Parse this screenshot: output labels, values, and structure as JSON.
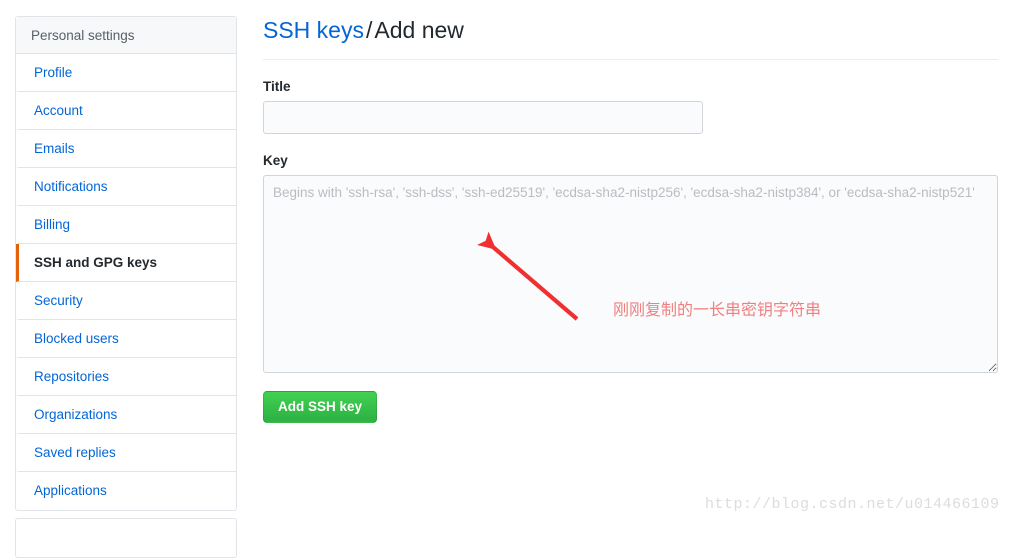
{
  "sidebar": {
    "header": "Personal settings",
    "items": [
      {
        "label": "Profile",
        "selected": false
      },
      {
        "label": "Account",
        "selected": false
      },
      {
        "label": "Emails",
        "selected": false
      },
      {
        "label": "Notifications",
        "selected": false
      },
      {
        "label": "Billing",
        "selected": false
      },
      {
        "label": "SSH and GPG keys",
        "selected": true
      },
      {
        "label": "Security",
        "selected": false
      },
      {
        "label": "Blocked users",
        "selected": false
      },
      {
        "label": "Repositories",
        "selected": false
      },
      {
        "label": "Organizations",
        "selected": false
      },
      {
        "label": "Saved replies",
        "selected": false
      },
      {
        "label": "Applications",
        "selected": false
      }
    ],
    "active_indicator_color": "#e36209"
  },
  "main": {
    "breadcrumb": {
      "link": "SSH keys",
      "separator": "/",
      "current": "Add new"
    },
    "form": {
      "title_label": "Title",
      "title_value": "",
      "title_placeholder": "",
      "key_label": "Key",
      "key_value": "",
      "key_placeholder": "Begins with 'ssh-rsa', 'ssh-dss', 'ssh-ed25519', 'ecdsa-sha2-nistp256', 'ecdsa-sha2-nistp384', or 'ecdsa-sha2-nistp521'",
      "submit_label": "Add SSH key",
      "submit_color": "#2eb344"
    }
  },
  "annotations": {
    "arrow_color": "#f03030",
    "note_text": "刚刚复制的一长串密钥字符串",
    "note_color": "#f08080",
    "watermark": "http://blog.csdn.net/u014466109"
  }
}
